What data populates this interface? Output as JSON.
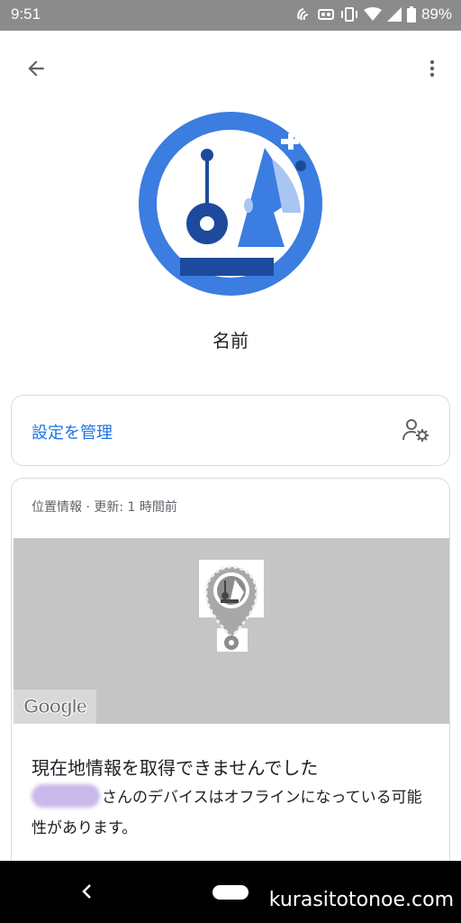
{
  "status_bar": {
    "time": "9:51",
    "battery": "89%"
  },
  "app_bar": {
    "back_icon": "arrow-left-icon",
    "more_icon": "more-vert-icon"
  },
  "device": {
    "name": "名前",
    "accent_color": "#3b7de0"
  },
  "manage": {
    "label": "設定を管理",
    "icon": "person-gear-icon"
  },
  "location": {
    "header": "位置情報 · 更新: 1 時間前",
    "map_logo": "Google",
    "offline_title": "現在地情報を取得できませんでした",
    "offline_body": "さんのデバイスはオフラインになっている可能性があります。"
  },
  "watermark": "kurasitotonoe.com"
}
